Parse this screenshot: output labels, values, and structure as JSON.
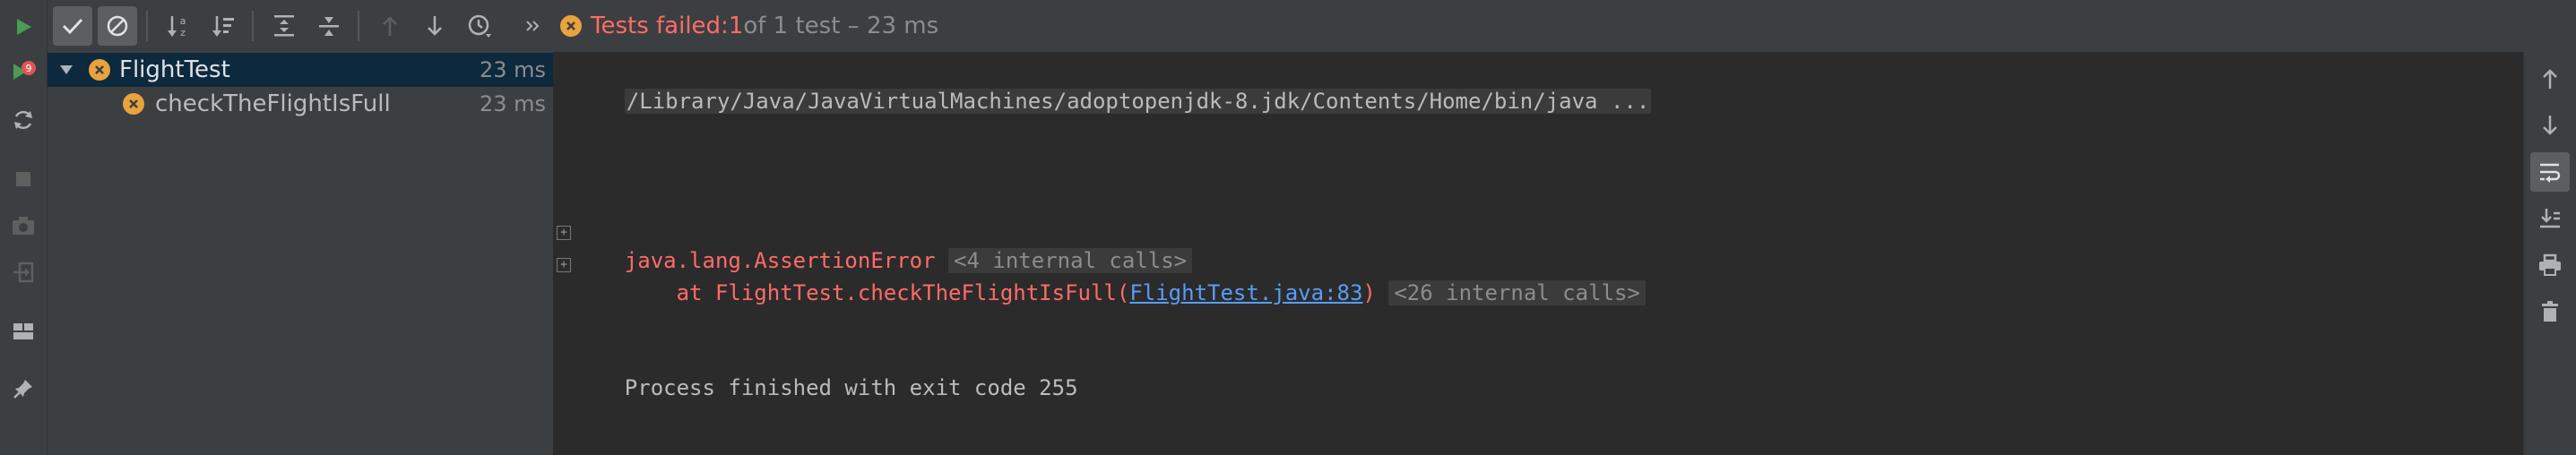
{
  "status": {
    "failed_label": "Tests failed: ",
    "failed_count": "1",
    "summary": " of 1 test – 23 ms"
  },
  "tree": {
    "items": [
      {
        "name": "FlightTest",
        "time": "23 ms"
      },
      {
        "name": "checkTheFlightIsFull",
        "time": "23 ms"
      }
    ]
  },
  "console": {
    "cmd": "/Library/Java/JavaVirtualMachines/adoptopenjdk-8.jdk/Contents/Home/bin/java ...",
    "error": "java.lang.AssertionError",
    "internal1": "<4 internal calls>",
    "at_prefix": "    at FlightTest.checkTheFlightIsFull(",
    "link": "FlightTest.java:83",
    "at_suffix": ")",
    "internal2": "<26 internal calls>",
    "exit": "Process finished with exit code 255"
  },
  "icons": {
    "left": [
      "run-icon",
      "rerun-failed-icon",
      "toggle-auto-test-icon",
      "stop-icon",
      "camera-icon",
      "exit-icon",
      "layout-icon",
      "pin-icon"
    ],
    "toolbar": [
      "show-passed-icon",
      "show-ignored-icon",
      "sort-alpha-icon",
      "sort-duration-icon",
      "expand-all-icon",
      "collapse-all-icon",
      "prev-failed-icon",
      "next-failed-icon",
      "history-icon",
      "more-icon"
    ],
    "right": [
      "up-arrow-icon",
      "down-arrow-icon",
      "soft-wrap-icon",
      "scroll-end-icon",
      "print-icon",
      "trash-icon"
    ]
  },
  "colors": {
    "fail": "#ff6b68",
    "run": "#499c54",
    "warn": "#e8a33d",
    "link": "#589df6"
  }
}
